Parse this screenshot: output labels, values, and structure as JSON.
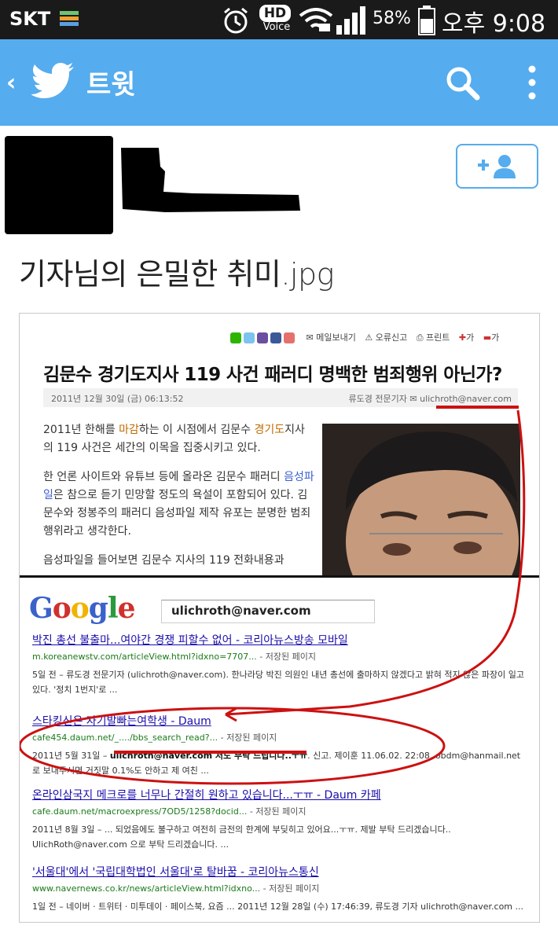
{
  "status_bar": {
    "carrier": "SKT",
    "hd": "HD",
    "voice": "Voice",
    "battery_percent": "58%",
    "time": "오후 9:08"
  },
  "app_bar": {
    "back_glyph": "‹",
    "title": "트윗",
    "icons": [
      "twitter-bird-icon",
      "search-icon",
      "more-vert-icon"
    ]
  },
  "tweet": {
    "text": "기자님의 은밀한 취미",
    "text_ext": ".jpg"
  },
  "article": {
    "share_items": [
      "메일보내기",
      "오류신고",
      "프린트"
    ],
    "font_size_plus": "가",
    "font_size_minus": "가",
    "headline": "김문수 경기도지사 119 사건 패러디 명백한 범죄행위 아닌가?",
    "date": "2011년 12월 30일 (금) 06:13:52",
    "author": "류도경 전문기자",
    "email": "ulichroth@naver.com",
    "paragraphs": [
      {
        "a": "2011년 한해를 ",
        "b": "마감",
        "c": "하는 이 시점에서 김문수 ",
        "d": "경기도",
        "e": "지사의 119 사건은 세간의 이목을 집중시키고 있다."
      },
      {
        "a": "한 언론 사이트와 유튜브 등에 올라온 김문수 패러디 ",
        "b": "음성파일",
        "c": "은 참으로 듣기 민망할 정도의 욕설이 포함되어 있다. 김문수와 정봉주의 패러디 음성파일 제작 유포는 분명한 범죄행위라고 생각한다."
      },
      {
        "a": "음성파일을 들어보면 김문수 지사의 119 전화내용과"
      }
    ]
  },
  "google": {
    "logo": "Google",
    "query": "ulichroth@naver.com",
    "results": [
      {
        "title": "박진 총선 불출마...여야간 경쟁 피할수 없어 - 코리아뉴스방송 모바일",
        "url": "m.koreanewstv.com/articleView.html?idxno=7707...",
        "cached": " - 저장된 페이지",
        "snippet": "5일 전 – 류도경 전문기자 (ulichroth@naver.com). 한나라당 박진 의원인 내년 총선에 출마하지 않겠다고 밝혀 적지 않은 파장이 일고있다. '정치 1번지'로 ..."
      },
      {
        "title": "스타킹신은 자기발빠는여학생 - Daum",
        "url": "cafe454.daum.net/_..../bbs_search_read?...",
        "cached": " - 저장된 페이지",
        "snippet_pre": "2011년 5월 31일 – ",
        "snippet_em": "ulichroth@naver.com 저도 부탁 드립니다..ㅜㅠ",
        "snippet_post": ". 신고. 제이훈 11.06.02. 22:08. obdm@hanmail.net로 보내주시면 거짓말 0.1%도 안하고 제 여친 ..."
      },
      {
        "title": "온라인삼국지 메크로를 너무나 간절히 원하고 있습니다...ㅜㅠ - Daum 카페",
        "url": "cafe.daum.net/macroexpress/7OD5/1258?docid...",
        "cached": " - 저장된 페이지",
        "snippet": "2011년 8월 3일 – ... 되었음에도 불구하고 여전히 금전의 한계에 부딪히고 있어요...ㅜㅠ. 제발 부탁 드리겠습니다.. UlichRoth@naver.com 으로 부탁 드리겠습니다. ..."
      },
      {
        "title": "'서울대'에서 '국립대학법인 서울대'로 탈바꿈 - 코리아뉴스통신",
        "url": "www.navernews.co.kr/news/articleView.html?idxno...",
        "cached": " - 저장된 페이지",
        "snippet": "1일 전 – 네이버 · 트위터 · 미투데이 · 페이스북, 요즘 ... 2011년 12월 28일 (수) 17:46:39, 류도경 기자 ulichroth@naver.com ..."
      }
    ]
  },
  "colors": {
    "twitter_blue": "#55acee",
    "status_bar": "#1a1a1a",
    "annotation_red": "#cc1111",
    "link_blue": "#1a0dab",
    "url_green": "#1a7a1a"
  }
}
